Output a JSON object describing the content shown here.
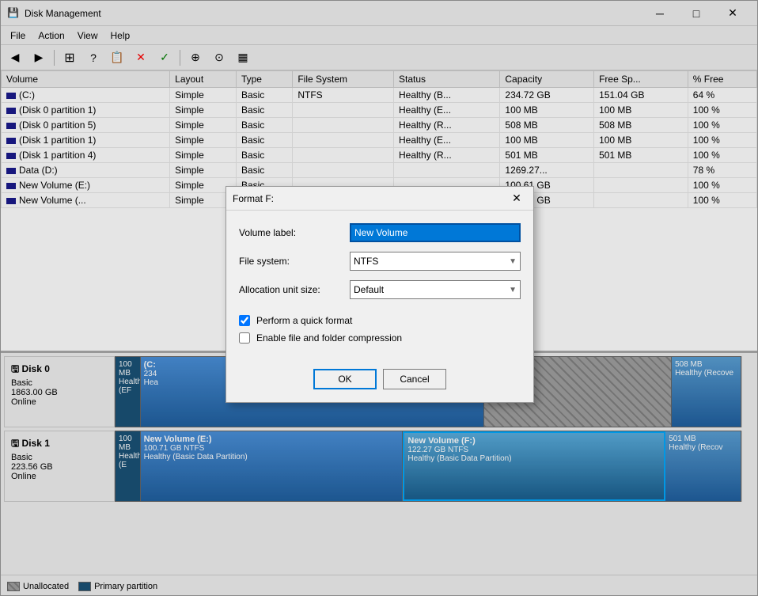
{
  "window": {
    "title": "Disk Management",
    "icon": "💾"
  },
  "menu": {
    "items": [
      "File",
      "Action",
      "View",
      "Help"
    ]
  },
  "toolbar": {
    "buttons": [
      "◀",
      "▶",
      "⊞",
      "?",
      "📋",
      "✕",
      "✓",
      "⊕",
      "⊙",
      "▦"
    ]
  },
  "table": {
    "columns": [
      "Volume",
      "Layout",
      "Type",
      "File System",
      "Status",
      "Capacity",
      "Free Sp...",
      "% Free"
    ],
    "rows": [
      {
        "volume": "(C:)",
        "layout": "Simple",
        "type": "Basic",
        "fs": "NTFS",
        "status": "Healthy (B...",
        "capacity": "234.72 GB",
        "free": "151.04 GB",
        "pct": "64 %"
      },
      {
        "volume": "(Disk 0 partition 1)",
        "layout": "Simple",
        "type": "Basic",
        "fs": "",
        "status": "Healthy (E...",
        "capacity": "100 MB",
        "free": "100 MB",
        "pct": "100 %"
      },
      {
        "volume": "(Disk 0 partition 5)",
        "layout": "Simple",
        "type": "Basic",
        "fs": "",
        "status": "Healthy (R...",
        "capacity": "508 MB",
        "free": "508 MB",
        "pct": "100 %"
      },
      {
        "volume": "(Disk 1 partition 1)",
        "layout": "Simple",
        "type": "Basic",
        "fs": "",
        "status": "Healthy (E...",
        "capacity": "100 MB",
        "free": "100 MB",
        "pct": "100 %"
      },
      {
        "volume": "(Disk 1 partition 4)",
        "layout": "Simple",
        "type": "Basic",
        "fs": "",
        "status": "Healthy (R...",
        "capacity": "501 MB",
        "free": "501 MB",
        "pct": "100 %"
      },
      {
        "volume": "Data (D:)",
        "layout": "Simple",
        "type": "Basic",
        "fs": "",
        "status": "",
        "capacity": "1269.27...",
        "free": "",
        "pct": "78 %"
      },
      {
        "volume": "New Volume (E:)",
        "layout": "Simple",
        "type": "Basic",
        "fs": "",
        "status": "",
        "capacity": "100.61 GB",
        "free": "",
        "pct": "100 %"
      },
      {
        "volume": "New Volume (...",
        "layout": "Simple",
        "type": "Basic",
        "fs": "",
        "status": "",
        "capacity": "122.17 GB",
        "free": "",
        "pct": "100 %"
      }
    ]
  },
  "disks": [
    {
      "name": "Disk 0",
      "type": "Basic",
      "size": "1863.00 GB",
      "status": "Online",
      "partitions": [
        {
          "label": "",
          "size": "100 MB",
          "status": "Healthy (EF",
          "type": "system",
          "width": 3
        },
        {
          "label": "(C:",
          "size": "234",
          "status": "Hea",
          "type": "primary",
          "width": 55
        },
        {
          "label": "",
          "size": "",
          "status": "",
          "type": "unallocated",
          "width": 32
        },
        {
          "label": "",
          "size": "508 MB",
          "status": "Healthy (Recove",
          "type": "recovery",
          "width": 10
        }
      ]
    },
    {
      "name": "Disk 1",
      "type": "Basic",
      "size": "223.56 GB",
      "status": "Online",
      "partitions": [
        {
          "label": "",
          "size": "100 MB",
          "status": "Healthy (E",
          "type": "system",
          "width": 5
        },
        {
          "label": "New Volume  (E:)",
          "size": "100.71 GB NTFS",
          "status": "Healthy (Basic Data Partition)",
          "type": "primary",
          "width": 42
        },
        {
          "label": "New Volume  (F:)",
          "size": "122.27 GB NTFS",
          "status": "Healthy (Basic Data Partition)",
          "type": "primary",
          "width": 42,
          "highlighted": true
        },
        {
          "label": "",
          "size": "501 MB",
          "status": "Healthy (Recov",
          "type": "recovery",
          "width": 11
        }
      ]
    }
  ],
  "status_bar": {
    "unallocated_label": "Unallocated",
    "primary_label": "Primary partition"
  },
  "dialog": {
    "title": "Format F:",
    "volume_label_text": "Volume label:",
    "volume_label_value": "New Volume",
    "file_system_label": "File system:",
    "file_system_value": "NTFS",
    "alloc_label": "Allocation unit size:",
    "alloc_value": "Default",
    "quick_format_label": "Perform a quick format",
    "compress_label": "Enable file and folder compression",
    "ok_label": "OK",
    "cancel_label": "Cancel"
  }
}
